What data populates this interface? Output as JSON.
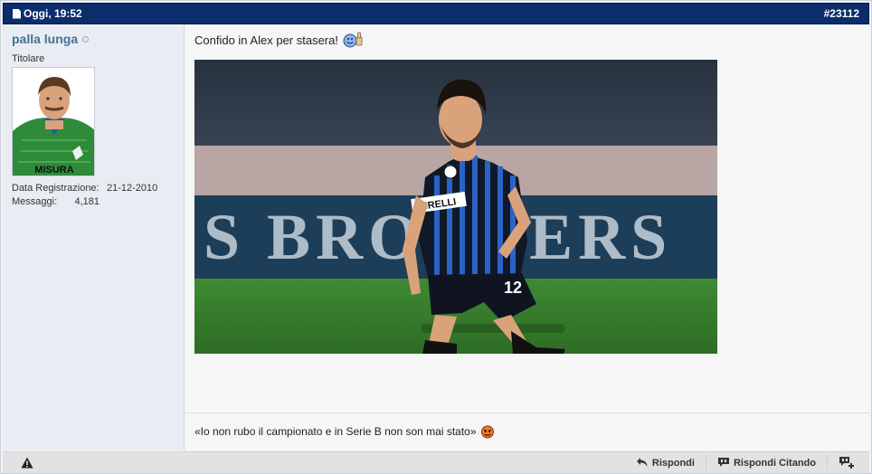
{
  "post": {
    "date": "Oggi, 19:52",
    "number": "#23112"
  },
  "user": {
    "name": "palla lunga",
    "title": "Titolare",
    "join_label": "Data Registrazione:",
    "join_value": "21-12-2010",
    "posts_label": "Messaggi:",
    "posts_value": "4,181"
  },
  "content": {
    "message": "Confido in Alex per stasera!",
    "photo_banner": "S BROTHERS",
    "player_number": "12",
    "sponsor": "PIRELLI",
    "signature": "«Io non rubo il campionato e in Serie B non son mai stato»",
    "avatar_text": "MISURA"
  },
  "footer": {
    "reply": "Rispondi",
    "reply_quote": "Rispondi Citando"
  },
  "colors": {
    "header_bg": "#0c2d6b",
    "username": "#417394"
  },
  "icons": [
    "document-icon",
    "online-status-icon",
    "thumbs-up-smiley-icon",
    "devil-smiley-icon",
    "warning-icon",
    "reply-icon",
    "quote-icon",
    "multiquote-plus-icon"
  ]
}
